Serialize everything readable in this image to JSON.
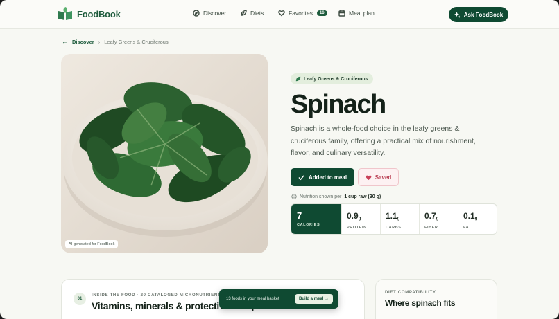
{
  "header": {
    "brand": "FoodBook",
    "nav": [
      {
        "label": "Discover",
        "icon": "compass-icon"
      },
      {
        "label": "Diets",
        "icon": "leaf-icon"
      },
      {
        "label": "Favorites",
        "icon": "heart-icon",
        "badge": "16"
      },
      {
        "label": "Meal plan",
        "icon": "calendar-icon"
      }
    ],
    "ask_label": "Ask FoodBook"
  },
  "breadcrumb": {
    "back_label": "Discover",
    "current": "Leafy Greens & Cruciferous"
  },
  "hero": {
    "image_caption": "AI-generated for FoodBook",
    "category": "Leafy Greens & Cruciferous",
    "title": "Spinach",
    "description": "Spinach is a whole-food choice in the leafy greens & cruciferous family, offering a practical mix of nourishment, flavor, and culinary versatility.",
    "added_label": "Added to meal",
    "saved_label": "Saved",
    "nutrition_note_prefix": "Nutrition shown per",
    "nutrition_note_portion": "1 cup raw (30 g)"
  },
  "nutrition": [
    {
      "value": "7",
      "unit": "",
      "label": "CALORIES"
    },
    {
      "value": "0.9",
      "unit": "g",
      "label": "PROTEIN"
    },
    {
      "value": "1.1",
      "unit": "g",
      "label": "CARBS"
    },
    {
      "value": "0.7",
      "unit": "g",
      "label": "FIBER"
    },
    {
      "value": "0.1",
      "unit": "g",
      "label": "FAT"
    }
  ],
  "inside_card": {
    "number": "01",
    "kicker": "INSIDE THE FOOD · 20 CATALOGED MICRONUTRIENTS",
    "title": "Vitamins, minerals & protective compounds"
  },
  "diet_card": {
    "kicker": "DIET COMPATIBILITY",
    "title": "Where spinach fits"
  },
  "basket": {
    "text": "13 foods in your meal basket",
    "button": "Build a meal →"
  },
  "colors": {
    "brand_green": "#0f4a32",
    "background": "#f7f8f3",
    "saved_red": "#b83b50"
  }
}
